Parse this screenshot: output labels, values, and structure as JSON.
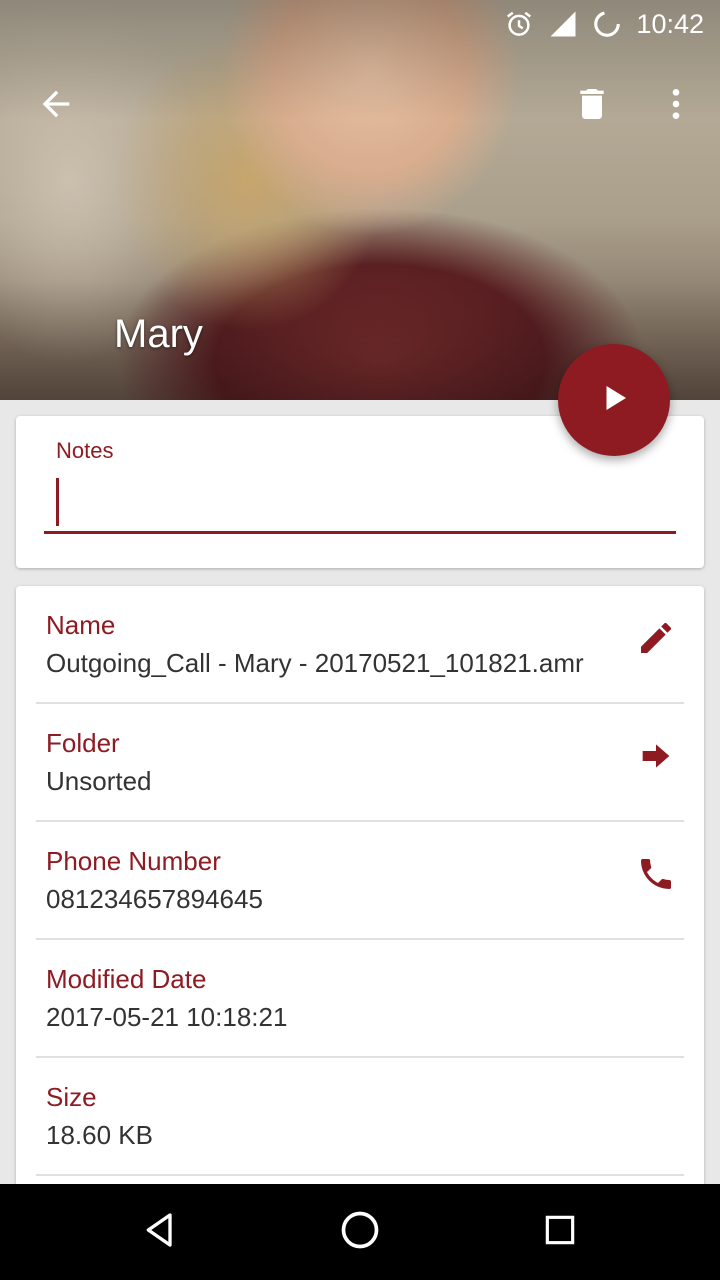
{
  "status_bar": {
    "time": "10:42",
    "icons": [
      "alarm-icon",
      "cell-signal-icon",
      "sync-icon"
    ]
  },
  "header": {
    "contact_name": "Mary"
  },
  "toolbar": {
    "back_icon": "arrow-back-icon",
    "delete_icon": "trash-icon",
    "more_icon": "more-vert-icon"
  },
  "fab": {
    "icon": "play-icon"
  },
  "notes": {
    "label": "Notes",
    "value": "",
    "placeholder": ""
  },
  "details": [
    {
      "label": "Name",
      "value": "Outgoing_Call - Mary - 20170521_101821.amr",
      "action_icon": "edit-pencil-icon"
    },
    {
      "label": "Folder",
      "value": "Unsorted",
      "action_icon": "move-arrow-icon"
    },
    {
      "label": "Phone Number",
      "value": "081234657894645",
      "action_icon": "phone-icon"
    },
    {
      "label": "Modified Date",
      "value": "2017-05-21 10:18:21"
    },
    {
      "label": "Size",
      "value": "18.60 KB"
    }
  ],
  "colors": {
    "accent": "#8e1b22",
    "text": "#333333",
    "background": "#e8e8e8"
  },
  "navbar": {
    "icons": [
      "nav-back-icon",
      "nav-home-icon",
      "nav-recents-icon"
    ]
  }
}
